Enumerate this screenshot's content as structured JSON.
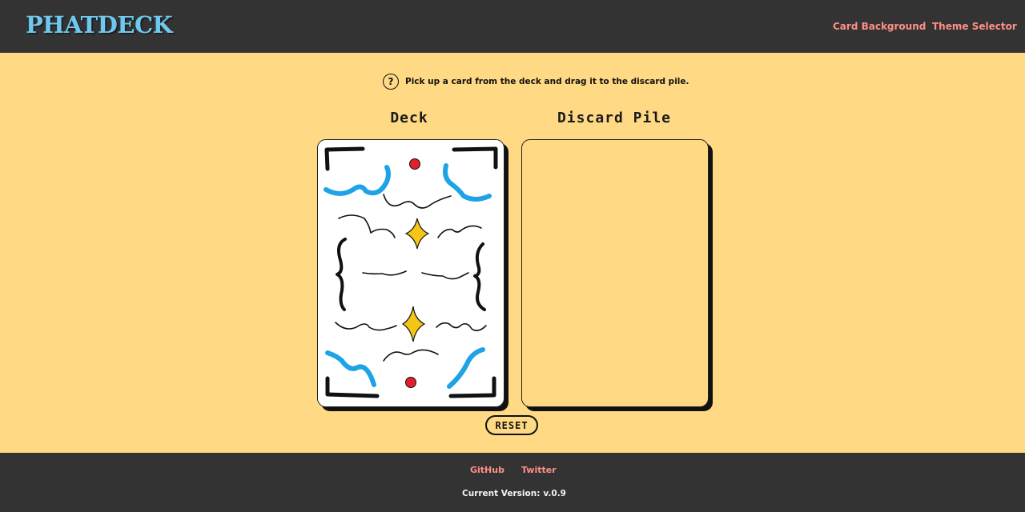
{
  "header": {
    "logo": "PHATDECK",
    "nav": {
      "card_background": "Card Background",
      "theme_selector": "Theme Selector"
    }
  },
  "instructions": {
    "icon": "help-icon",
    "icon_glyph": "?",
    "text": "Pick up a card from the deck and drag it to the discard pile."
  },
  "deck": {
    "title": "Deck"
  },
  "discard": {
    "title": "Discard Pile"
  },
  "controls": {
    "reset_label": "RESET"
  },
  "footer": {
    "github": "GitHub",
    "twitter": "Twitter",
    "version_label": "Current Version:",
    "version_value": "v.0.9"
  },
  "colors": {
    "background": "#ffd983",
    "bars": "#333333",
    "logo": "#6ec8ef",
    "link": "#ff8f86",
    "card_blue": "#1ea3e6",
    "card_red": "#e2202c",
    "card_star": "#f5c518"
  }
}
